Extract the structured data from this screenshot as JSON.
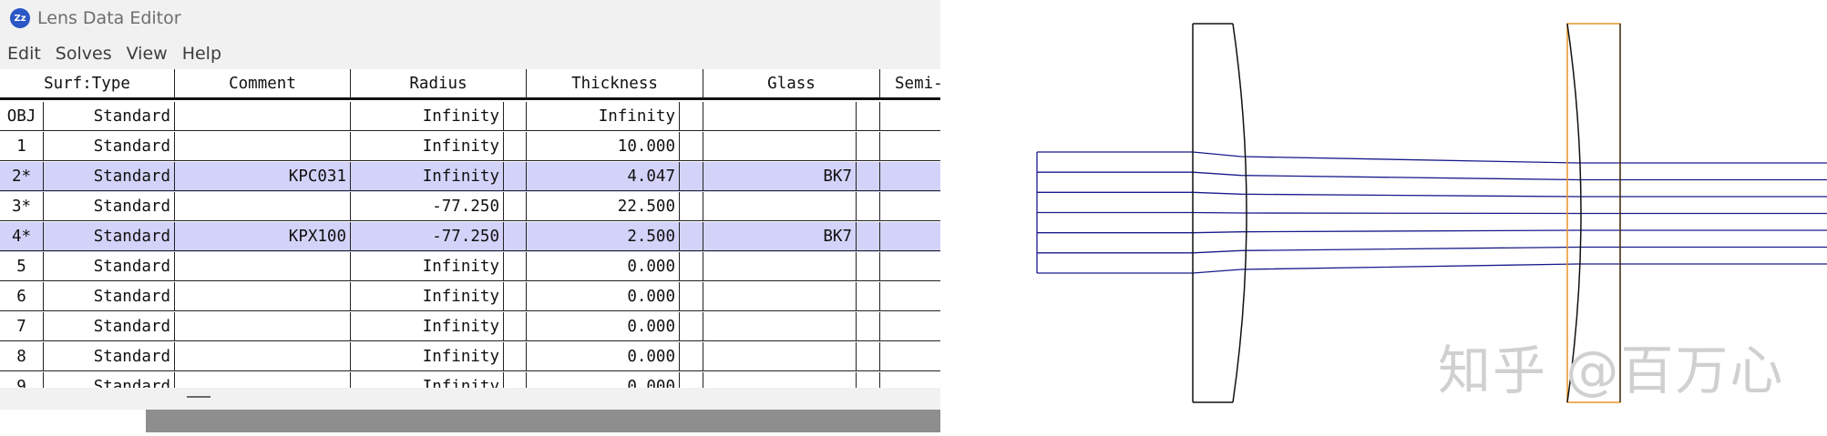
{
  "window": {
    "title": "Lens Data Editor",
    "icon_label": "Zz",
    "menu": [
      "Edit",
      "Solves",
      "View",
      "Help"
    ]
  },
  "table": {
    "headers": [
      "Surf:Type",
      "Comment",
      "Radius",
      "Thickness",
      "Glass",
      "Semi-"
    ],
    "rows": [
      {
        "surf": "OBJ",
        "type": "Standard",
        "comment": "",
        "radius": "Infinity",
        "thickness": "Infinity",
        "glass": "",
        "selected": false
      },
      {
        "surf": "1",
        "type": "Standard",
        "comment": "",
        "radius": "Infinity",
        "thickness": "10.000",
        "glass": "",
        "selected": false
      },
      {
        "surf": "2*",
        "type": "Standard",
        "comment": "KPC031",
        "radius": "Infinity",
        "thickness": "4.047",
        "glass": "BK7",
        "selected": true
      },
      {
        "surf": "3*",
        "type": "Standard",
        "comment": "",
        "radius": "-77.250",
        "thickness": "22.500",
        "glass": "",
        "selected": false
      },
      {
        "surf": "4*",
        "type": "Standard",
        "comment": "KPX100",
        "radius": "-77.250",
        "thickness": "2.500",
        "glass": "BK7",
        "selected": true
      },
      {
        "surf": "5",
        "type": "Standard",
        "comment": "",
        "radius": "Infinity",
        "thickness": "0.000",
        "glass": "",
        "selected": false
      },
      {
        "surf": "6",
        "type": "Standard",
        "comment": "",
        "radius": "Infinity",
        "thickness": "0.000",
        "glass": "",
        "selected": false
      },
      {
        "surf": "7",
        "type": "Standard",
        "comment": "",
        "radius": "Infinity",
        "thickness": "0.000",
        "glass": "",
        "selected": false
      },
      {
        "surf": "8",
        "type": "Standard",
        "comment": "",
        "radius": "Infinity",
        "thickness": "0.000",
        "glass": "",
        "selected": false
      },
      {
        "surf": "9",
        "type": "Standard",
        "comment": "",
        "radius": "Infinity",
        "thickness": "0.000",
        "glass": "",
        "selected": false
      }
    ]
  },
  "layout": {
    "ray_color": "#1a1a8c",
    "lens_color": "#111111",
    "highlight_color": "#e8962a"
  },
  "watermark": "知乎 @百万心",
  "colors": {
    "selected_row": "#d3d3fa",
    "window_bg": "#f1f1f1"
  }
}
